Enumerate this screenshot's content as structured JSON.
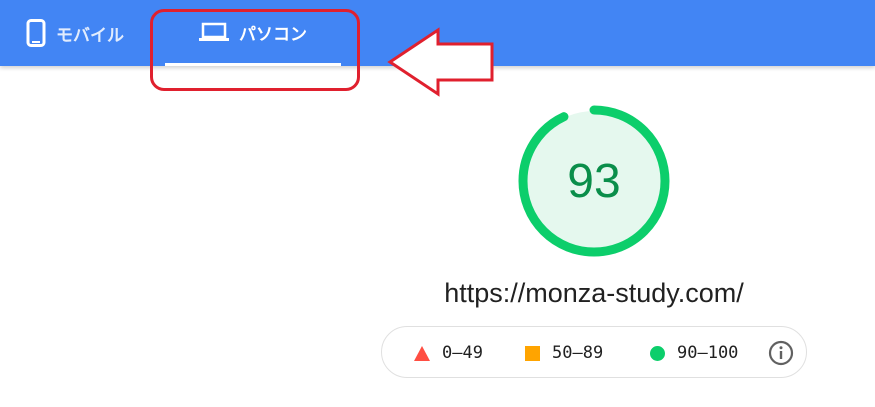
{
  "tabs": [
    {
      "label": "モバイル",
      "icon": "smartphone-icon",
      "selected": false
    },
    {
      "label": "パソコン",
      "icon": "laptop-icon",
      "selected": true
    }
  ],
  "score": {
    "value": "93",
    "fraction": 0.93
  },
  "url": "https://monza-study.com/",
  "legend": {
    "fail": {
      "label": "0–49",
      "icon": "red-triangle-icon",
      "color": "#ff4e42"
    },
    "average": {
      "label": "50–89",
      "icon": "orange-square-icon",
      "color": "#ffa400"
    },
    "pass": {
      "label": "90–100",
      "icon": "green-circle-icon",
      "color": "#0cce6b"
    },
    "info_icon": "info-icon"
  },
  "colors": {
    "topbar": "#4285f4",
    "annotation_red": "#e0202e",
    "gauge_green": "#0cce6b",
    "gauge_fill": "#e5f8ee",
    "score_text": "#0a8e4a"
  }
}
